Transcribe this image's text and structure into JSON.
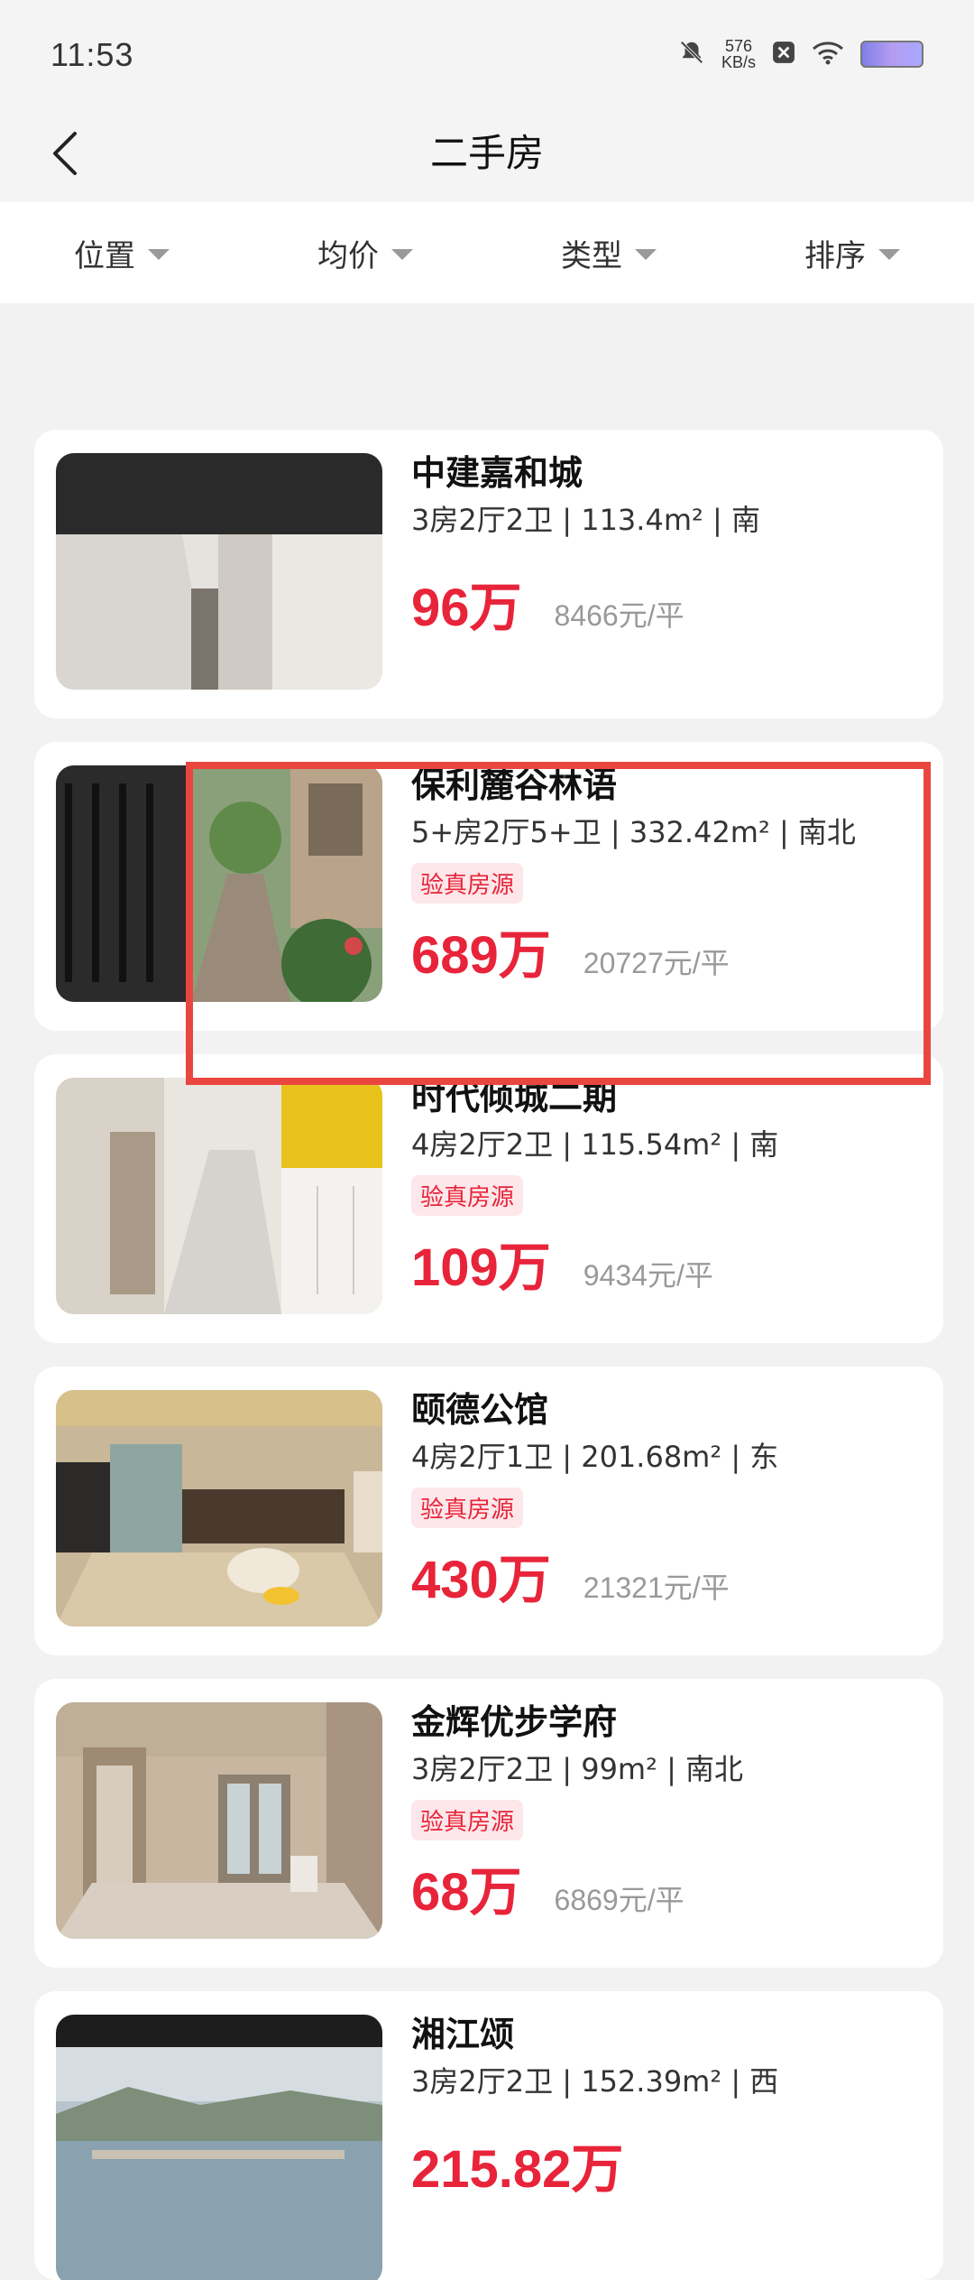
{
  "status_bar": {
    "time": "11:53",
    "net_speed_value": "576",
    "net_speed_unit": "KB/s",
    "icons": [
      "bell-off-icon",
      "close-square-icon",
      "wifi-icon",
      "battery-icon"
    ]
  },
  "nav": {
    "title": "二手房",
    "back_icon": "chevron-left-icon"
  },
  "filters": [
    {
      "label": "位置"
    },
    {
      "label": "均价"
    },
    {
      "label": "类型"
    },
    {
      "label": "排序"
    }
  ],
  "listings": [
    {
      "title": "中建嘉和城",
      "desc": "3房2厅2卫 | 113.4m² | 南",
      "badge": "",
      "price": "96万",
      "unit_price": "8466元/平"
    },
    {
      "title": "保利麓谷林语",
      "desc": "5+房2厅5+卫 | 332.42m² | 南北",
      "badge": "验真房源",
      "price": "689万",
      "unit_price": "20727元/平"
    },
    {
      "title": "时代倾城二期",
      "desc": "4房2厅2卫 | 115.54m² | 南",
      "badge": "验真房源",
      "price": "109万",
      "unit_price": "9434元/平"
    },
    {
      "title": "颐德公馆",
      "desc": "4房2厅1卫 | 201.68m² | 东",
      "badge": "验真房源",
      "price": "430万",
      "unit_price": "21321元/平"
    },
    {
      "title": "金辉优步学府",
      "desc": "3房2厅2卫 | 99m² | 南北",
      "badge": "验真房源",
      "price": "68万",
      "unit_price": "6869元/平"
    },
    {
      "title": "湘江颂",
      "desc": "3房2厅2卫 | 152.39m² | 西",
      "badge": "",
      "price": "215.82万",
      "unit_price": ""
    }
  ],
  "colors": {
    "accent_red": "#e8243a",
    "badge_bg": "#fde7ea",
    "highlight_border": "#e9463f",
    "page_bg": "#f2f2f2"
  }
}
